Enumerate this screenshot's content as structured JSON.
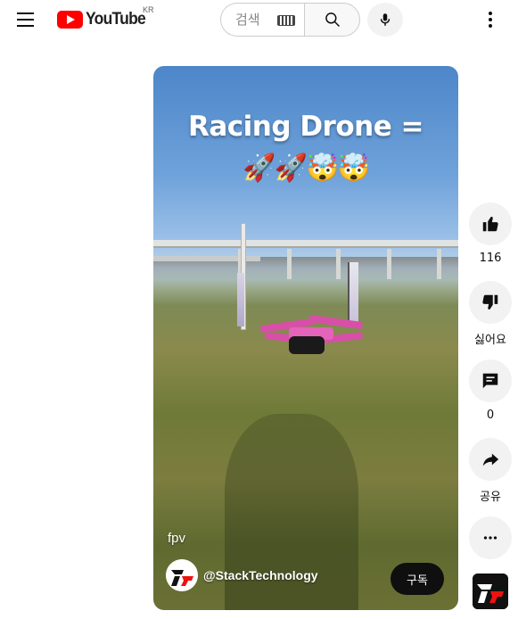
{
  "header": {
    "logo_text": "YouTube",
    "country_code": "KR",
    "search_placeholder": "검색",
    "icons": [
      "menu-icon",
      "youtube-logo-icon",
      "keyboard-icon",
      "search-icon",
      "microphone-icon",
      "more-vert-icon"
    ]
  },
  "video": {
    "overlay_title": "Racing Drone =",
    "overlay_emojis": "🚀🚀🤯🤯",
    "caption": "fpv",
    "channel_handle": "@StackTechnology",
    "subscribe_label": "구독"
  },
  "actions": {
    "like_count": "116",
    "dislike_label": "싫어요",
    "comment_count": "0",
    "share_label": "공유"
  },
  "colors": {
    "brand_red": "#ff0000",
    "action_bg": "#f2f2f2",
    "subscribe_bg": "#0f0f0f"
  }
}
